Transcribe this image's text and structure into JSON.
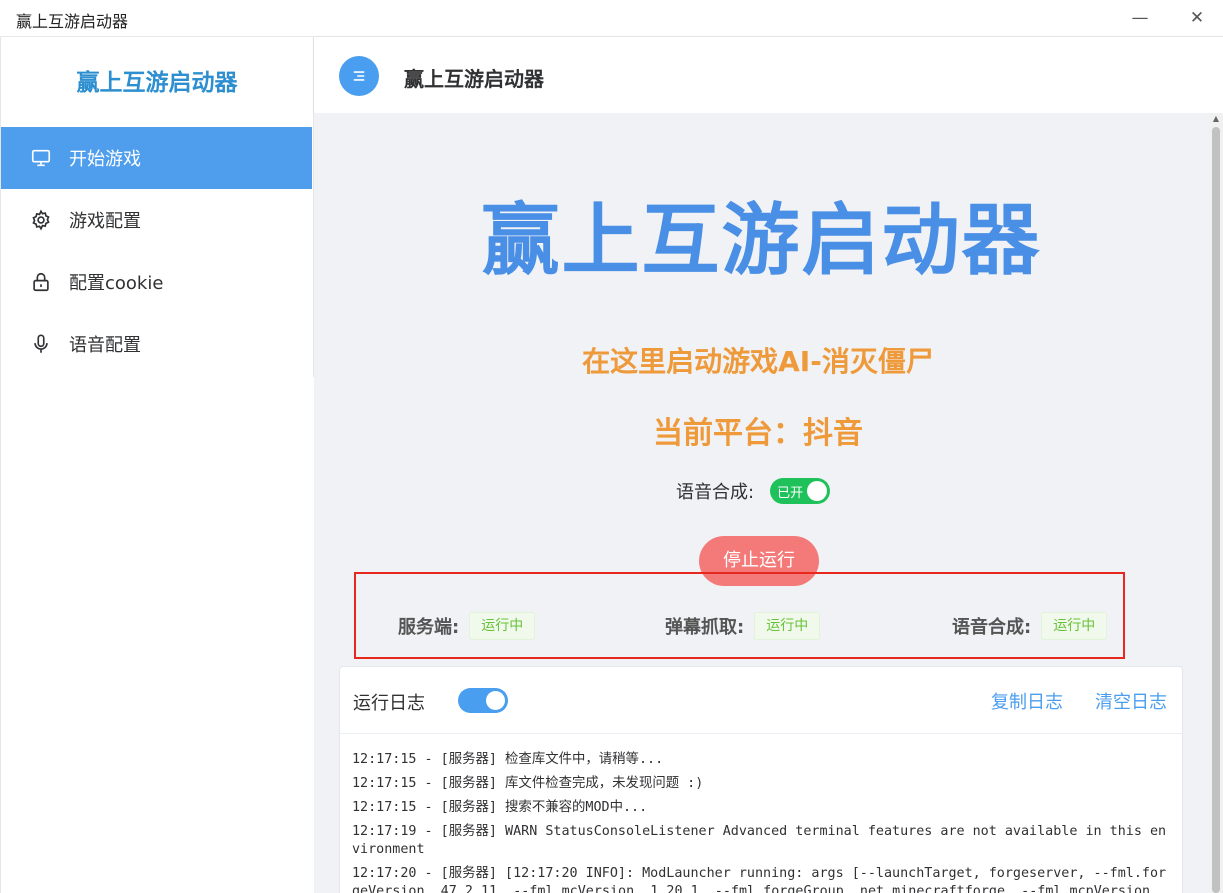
{
  "window": {
    "title": "赢上互游启动器",
    "minimize": "—",
    "close": "✕"
  },
  "sidebar": {
    "brand": "赢上互游启动器",
    "items": [
      {
        "label": "开始游戏",
        "icon": "monitor-icon",
        "active": true
      },
      {
        "label": "游戏配置",
        "icon": "gear-icon",
        "active": false
      },
      {
        "label": "配置cookie",
        "icon": "lock-icon",
        "active": false
      },
      {
        "label": "语音配置",
        "icon": "microphone-icon",
        "active": false
      }
    ]
  },
  "header": {
    "title": "赢上互游启动器",
    "menu_icon": "menu-icon"
  },
  "main": {
    "hero": "赢上互游启动器",
    "subtitle": "在这里启动游戏AI-消灭僵尸",
    "platform": "当前平台：抖音",
    "tts_label": "语音合成:",
    "tts_switch": "已开",
    "stop_button": "停止运行",
    "status": [
      {
        "label": "服务端:",
        "value": "运行中"
      },
      {
        "label": "弹幕抓取:",
        "value": "运行中"
      },
      {
        "label": "语音合成:",
        "value": "运行中"
      }
    ]
  },
  "log": {
    "title": "运行日志",
    "copy": "复制日志",
    "clear": "清空日志",
    "lines": [
      "12:17:15 - [服务器] 检查库文件中，请稍等...",
      "12:17:15 - [服务器] 库文件检查完成，未发现问题 :)",
      "12:17:15 - [服务器] 搜索不兼容的MOD中...",
      "12:17:19 - [服务器] WARN StatusConsoleListener Advanced terminal features are not available in this environment",
      "12:17:20 - [服务器] [12:17:20 INFO]: ModLauncher running: args [--launchTarget, forgeserver, --fml.forgeVersion, 47.2.11, --fml.mcVersion, 1.20.1, --fml.forgeGroup, net.minecraftforge, --fml.mcpVersion, 2"
    ]
  },
  "colors": {
    "accent": "#4f9eee",
    "orange": "#ee9a3a",
    "green": "#1fc25a",
    "stop": "#f47a7a",
    "box": "#e8271f"
  }
}
